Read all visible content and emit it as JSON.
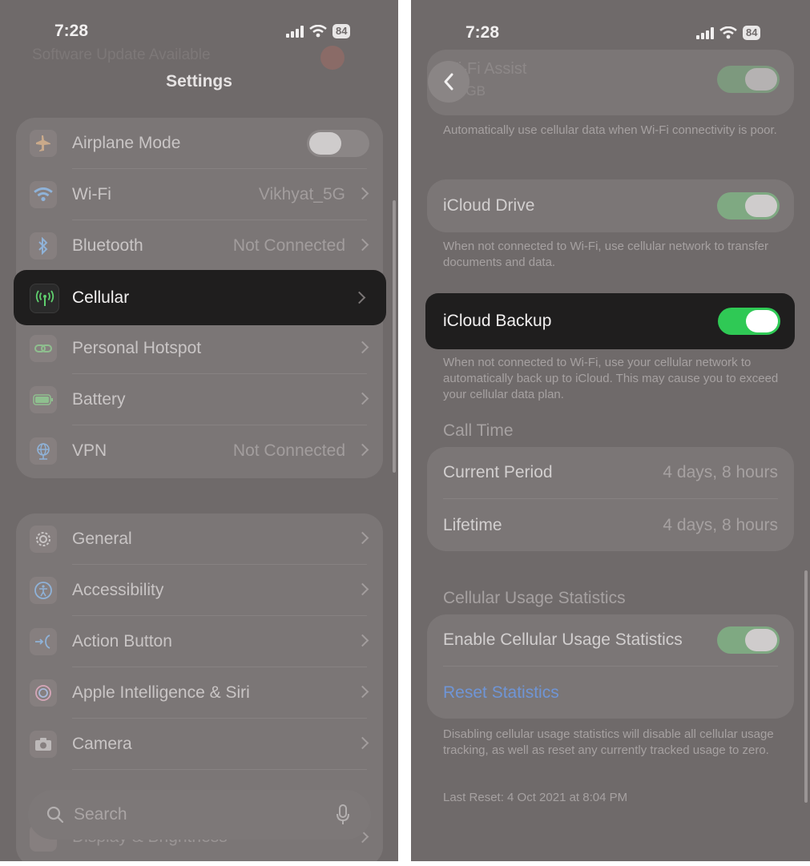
{
  "left": {
    "status": {
      "time": "7:28",
      "battery": "84"
    },
    "banner": "Software Update Available",
    "title": "Settings",
    "group1": [
      {
        "label": "Airplane Mode",
        "icon": "airplane-icon",
        "toggle": "off"
      },
      {
        "label": "Wi-Fi",
        "value": "Vikhyat_5G",
        "icon": "wifi-icon"
      },
      {
        "label": "Bluetooth",
        "value": "Not Connected",
        "icon": "bluetooth-icon"
      },
      {
        "label": "Cellular",
        "icon": "cellular-antenna-icon",
        "highlighted": true
      },
      {
        "label": "Personal Hotspot",
        "icon": "hotspot-link-icon"
      },
      {
        "label": "Battery",
        "icon": "battery-icon"
      },
      {
        "label": "VPN",
        "value": "Not Connected",
        "icon": "vpn-globe-icon"
      }
    ],
    "group2": [
      {
        "label": "General",
        "icon": "gear-icon"
      },
      {
        "label": "Accessibility",
        "icon": "accessibility-icon"
      },
      {
        "label": "Action Button",
        "icon": "action-button-icon"
      },
      {
        "label": "Apple Intelligence & Siri",
        "icon": "siri-icon"
      },
      {
        "label": "Camera",
        "icon": "camera-icon"
      },
      {
        "label": "Display & Brightness",
        "icon": "sun-icon"
      }
    ],
    "search": {
      "placeholder": "Search"
    }
  },
  "right": {
    "status": {
      "time": "7:28",
      "battery": "84"
    },
    "wifi_assist": {
      "label": "Wi-Fi Assist",
      "sub": "1.3 GB"
    },
    "wifi_assist_caption": "Automatically use cellular data when Wi-Fi connectivity is poor.",
    "icloud_drive": {
      "label": "iCloud Drive"
    },
    "icloud_drive_caption": "When not connected to Wi-Fi, use cellular network to transfer documents and data.",
    "icloud_backup": {
      "label": "iCloud Backup"
    },
    "icloud_backup_caption": "When not connected to Wi-Fi, use your cellular network to automatically back up to iCloud. This may cause you to exceed your cellular data plan.",
    "call_time": {
      "header": "Call Time",
      "current_label": "Current Period",
      "current_value": "4 days, 8 hours",
      "lifetime_label": "Lifetime",
      "lifetime_value": "4 days, 8 hours"
    },
    "usage": {
      "header": "Cellular Usage Statistics",
      "enable_label": "Enable Cellular Usage Statistics",
      "reset_label": "Reset Statistics",
      "caption": "Disabling cellular usage statistics will disable all cellular usage tracking, as well as reset any currently tracked usage to zero.",
      "last_reset": "Last Reset: 4 Oct 2021 at 8:04 PM"
    }
  },
  "colors": {
    "toggle_on": "#2fc955",
    "highlight_bg": "#1f1e1e",
    "link": "#6f95d6",
    "icon_green": "#5fcf6e"
  }
}
